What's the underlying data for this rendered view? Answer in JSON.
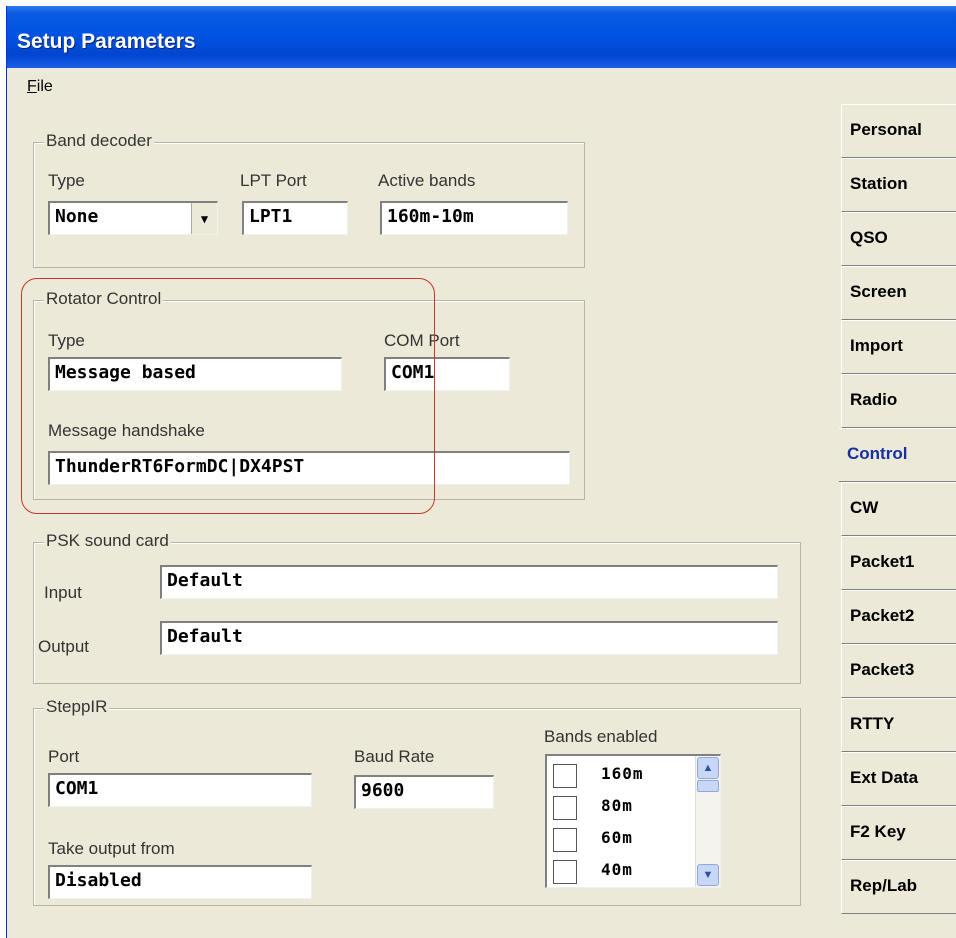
{
  "window": {
    "title": "Setup Parameters"
  },
  "menu": {
    "file": "File"
  },
  "band_decoder": {
    "legend": "Band decoder",
    "type_label": "Type",
    "type_value": "None",
    "lpt_label": "LPT Port",
    "lpt_value": "LPT1",
    "active_label": "Active bands",
    "active_value": "160m-10m"
  },
  "rotator": {
    "legend": "Rotator Control",
    "type_label": "Type",
    "type_value": "Message based",
    "com_label": "COM Port",
    "com_value": "COM1",
    "handshake_label": "Message handshake",
    "handshake_value": "ThunderRT6FormDC|DX4PST",
    "highlight_color": "#c0392b"
  },
  "psk": {
    "legend": "PSK sound card",
    "input_label": "Input",
    "input_value": "Default",
    "output_label": "Output",
    "output_value": "Default"
  },
  "steppir": {
    "legend": "SteppIR",
    "port_label": "Port",
    "port_value": "COM1",
    "baud_label": "Baud Rate",
    "baud_value": "9600",
    "take_label": "Take output from",
    "take_value": "Disabled",
    "bands_label": "Bands enabled",
    "bands": [
      "160m",
      "80m",
      "60m",
      "40m"
    ]
  },
  "tabs": [
    "Personal",
    "Station",
    "QSO",
    "Screen",
    "Import",
    "Radio",
    "Control",
    "CW",
    "Packet1",
    "Packet2",
    "Packet3",
    "RTTY",
    "Ext Data",
    "F2 Key",
    "Rep/Lab"
  ],
  "active_tab": "Control",
  "colors": {
    "titlebar": "#0054e3",
    "active_tab_text": "#1530a0",
    "window_bg": "#ece9d8"
  }
}
